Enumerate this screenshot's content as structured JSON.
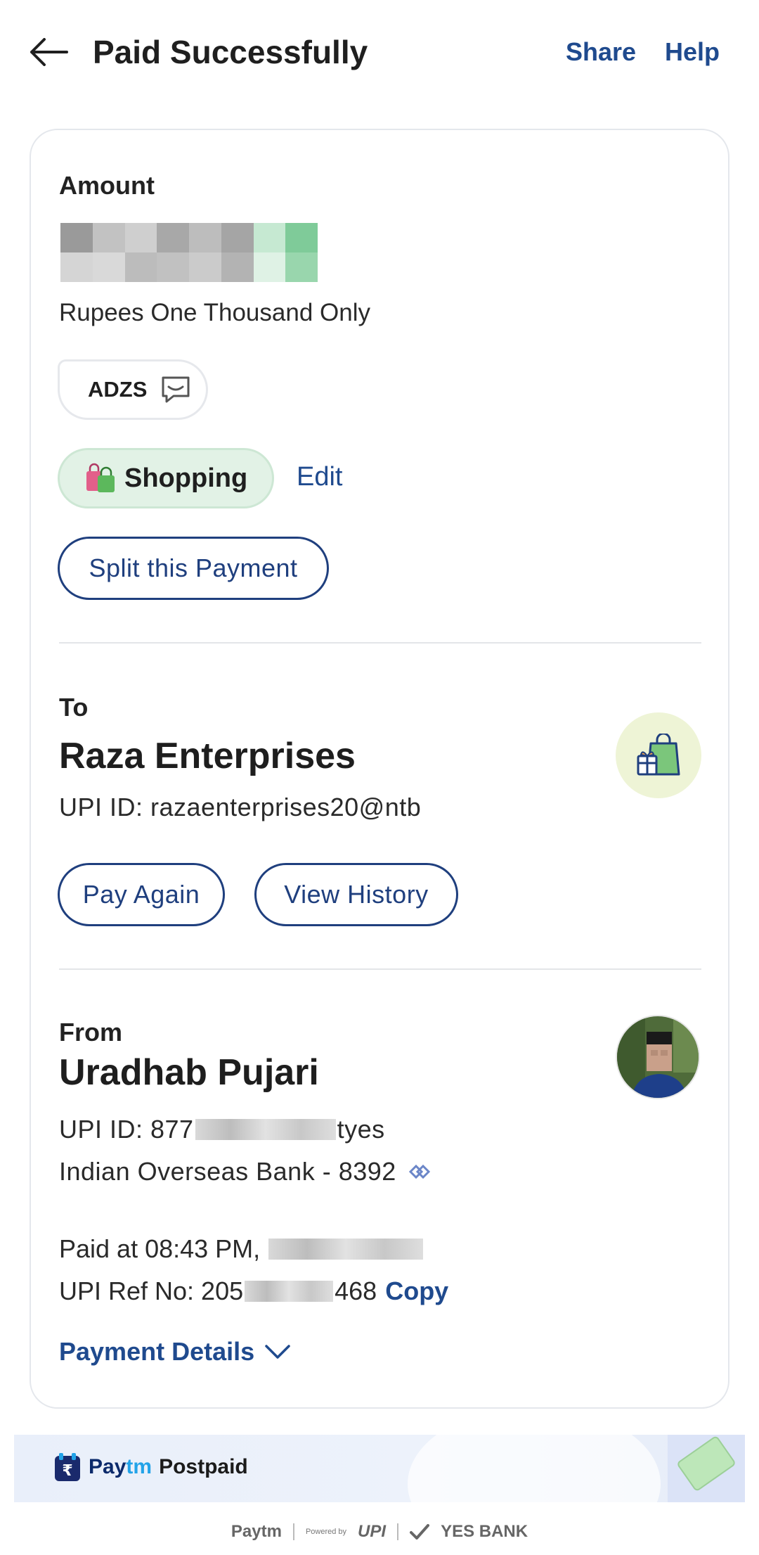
{
  "header": {
    "title": "Paid Successfully",
    "share_label": "Share",
    "help_label": "Help"
  },
  "amount": {
    "label": "Amount",
    "in_words": "Rupees One Thousand Only"
  },
  "note": {
    "text": "ADZS"
  },
  "category": {
    "label": "Shopping",
    "edit_label": "Edit"
  },
  "split_label": "Split this Payment",
  "to": {
    "label": "To",
    "name": "Raza Enterprises",
    "upi": "UPI ID: razaenterprises20@ntb",
    "pay_again_label": "Pay Again",
    "history_label": "View History"
  },
  "from": {
    "label": "From",
    "name": "Uradhab Pujari",
    "upi_prefix": "UPI ID: 877",
    "upi_suffix": "tyes",
    "bank": "Indian Overseas Bank - 8392"
  },
  "transaction": {
    "paid_at_prefix": "Paid at 08:43 PM,",
    "ref_prefix": "UPI Ref No: 205",
    "ref_suffix": "468",
    "copy_label": "Copy",
    "details_label": "Payment Details"
  },
  "banner": {
    "brand_pay": "Pay",
    "brand_tm": "tm",
    "product": "Postpaid"
  },
  "footer": {
    "paytm": "Paytm",
    "powered_by": "Powered by",
    "upi": "UPI",
    "bank": "YES BANK"
  },
  "colors": {
    "accent": "#1f4a8e",
    "category_bg": "#e2f2e6",
    "border": "#e4e7ec"
  },
  "icons": {
    "back": "arrow-left-icon",
    "note": "message-icon",
    "category": "shopping-bags-icon",
    "merchant": "gift-bag-icon",
    "bank_logo": "bank-logo-icon",
    "chevron": "chevron-down-icon"
  }
}
